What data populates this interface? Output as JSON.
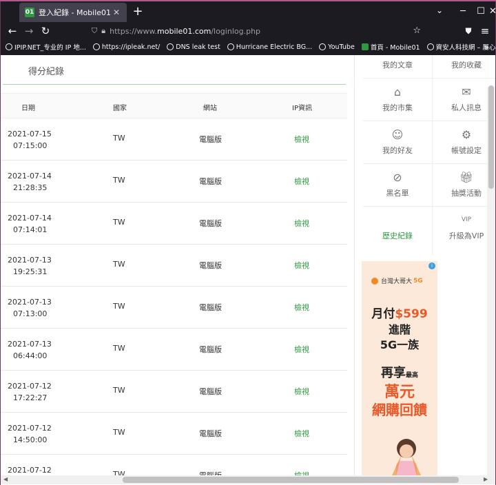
{
  "browser": {
    "tab_title": "登入紀錄 - Mobile01",
    "tab_favicon": "01",
    "url_prefix": "https://www.",
    "url_host": "mobile01.com",
    "url_path": "/loginlog.php",
    "bookmarks": [
      {
        "label": "IPIP.NET_专业的 IP 地..."
      },
      {
        "label": "https://ipleak.net/"
      },
      {
        "label": "DNS leak test"
      },
      {
        "label": "Hurricane Electric BG..."
      },
      {
        "label": "YouTube"
      },
      {
        "label": "首頁 - Mobile01"
      },
      {
        "label": "資安人科技網 – 屬心..."
      }
    ]
  },
  "page": {
    "section_title": "得分紀錄",
    "columns": [
      "日期",
      "國家",
      "網站",
      "IP資訊"
    ],
    "rows": [
      {
        "date": "2021-07-15",
        "time": "07:15:00",
        "country": "TW",
        "site": "電腦版",
        "ip": "檢視"
      },
      {
        "date": "2021-07-14",
        "time": "21:28:35",
        "country": "TW",
        "site": "電腦版",
        "ip": "檢視"
      },
      {
        "date": "2021-07-14",
        "time": "07:14:01",
        "country": "TW",
        "site": "電腦版",
        "ip": "檢視"
      },
      {
        "date": "2021-07-13",
        "time": "19:25:31",
        "country": "TW",
        "site": "電腦版",
        "ip": "檢視"
      },
      {
        "date": "2021-07-13",
        "time": "07:13:00",
        "country": "TW",
        "site": "電腦版",
        "ip": "檢視"
      },
      {
        "date": "2021-07-13",
        "time": "06:44:00",
        "country": "TW",
        "site": "電腦版",
        "ip": "檢視"
      },
      {
        "date": "2021-07-12",
        "time": "17:22:27",
        "country": "TW",
        "site": "電腦版",
        "ip": "檢視"
      },
      {
        "date": "2021-07-12",
        "time": "14:50:00",
        "country": "TW",
        "site": "電腦版",
        "ip": "檢視"
      },
      {
        "date": "2021-07-12",
        "time": "",
        "country": "TW",
        "site": "電腦版",
        "ip": "檢視"
      }
    ]
  },
  "sidebar": {
    "menu": [
      {
        "label": "我的文章",
        "icon": "article-icon"
      },
      {
        "label": "我的收藏",
        "icon": "bookmark-icon"
      },
      {
        "label": "我的市集",
        "icon": "store-icon"
      },
      {
        "label": "私人訊息",
        "icon": "mail-icon"
      },
      {
        "label": "我的好友",
        "icon": "friends-icon"
      },
      {
        "label": "帳號設定",
        "icon": "gear-icon"
      },
      {
        "label": "黑名單",
        "icon": "block-icon"
      },
      {
        "label": "抽獎活動",
        "icon": "gift-icon"
      },
      {
        "label": "歷史紀錄",
        "icon": "history-icon"
      },
      {
        "label": "升級為VIP",
        "icon": "vip-icon"
      }
    ],
    "ad": {
      "brand": "台灣大哥大",
      "brand_g": "5G",
      "line1a": "月付",
      "line1_price": "$599",
      "line2": "進階",
      "line3": "5G一族",
      "line4": "再享",
      "line4_small": "最高",
      "line5": "萬元",
      "line6": "網購回饋"
    }
  }
}
